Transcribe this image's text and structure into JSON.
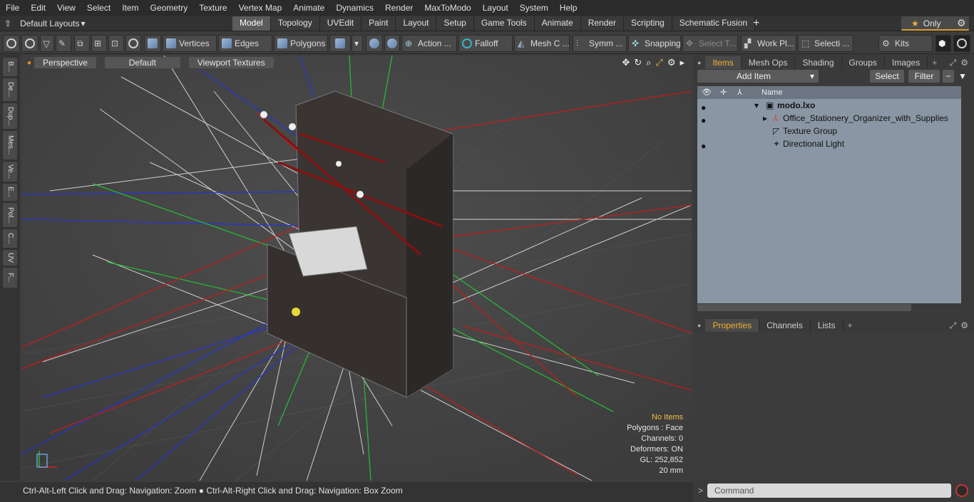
{
  "menu": [
    "File",
    "Edit",
    "View",
    "Select",
    "Item",
    "Geometry",
    "Texture",
    "Vertex Map",
    "Animate",
    "Dynamics",
    "Render",
    "MaxToModo",
    "Layout",
    "System",
    "Help"
  ],
  "layout_selector": "Default Layouts",
  "tabs": [
    {
      "label": "Model",
      "active": true
    },
    {
      "label": "Topology"
    },
    {
      "label": "UVEdit"
    },
    {
      "label": "Paint"
    },
    {
      "label": "Layout"
    },
    {
      "label": "Setup"
    },
    {
      "label": "Game Tools"
    },
    {
      "label": "Animate"
    },
    {
      "label": "Render"
    },
    {
      "label": "Scripting"
    },
    {
      "label": "Schematic Fusion"
    }
  ],
  "only_label": "Only",
  "toolbar": {
    "vertices": "Vertices",
    "edges": "Edges",
    "polygons": "Polygons",
    "action": "Action ...",
    "falloff": "Falloff",
    "mesh": "Mesh C ...",
    "symm": "Symm ...",
    "snapping": "Snapping",
    "select_t": "Select T...",
    "work_pl": "Work Pl...",
    "selecti": "Selecti ...",
    "kits": "Kits"
  },
  "left_tabs": [
    "B...",
    "De...",
    "Dup...",
    "Mes...",
    "Ve...",
    "E...",
    "Pol...",
    "C...",
    "UV",
    "F..."
  ],
  "viewport": {
    "view": "Perspective",
    "shading": "Default",
    "textures": "Viewport Textures",
    "info": {
      "no_items": "No Items",
      "polygons": "Polygons : Face",
      "channels": "Channels: 0",
      "deformers": "Deformers: ON",
      "gl": "GL: 252,852",
      "scale": "20 mm"
    }
  },
  "status": "Ctrl-Alt-Left Click and Drag: Navigation: Zoom ● Ctrl-Alt-Right Click and Drag: Navigation: Box Zoom",
  "right_panel": {
    "tabs": [
      "Items",
      "Mesh Ops",
      "Shading",
      "Groups",
      "Images"
    ],
    "add_item": "Add Item",
    "select": "Select",
    "filter": "Filter",
    "column_name": "Name",
    "items": [
      {
        "label": "modo.lxo"
      },
      {
        "label": "Office_Stationery_Organizer_with_Supplies"
      },
      {
        "label": "Texture Group"
      },
      {
        "label": "Directional Light"
      }
    ],
    "bottom_tabs": [
      "Properties",
      "Channels",
      "Lists"
    ],
    "command_placeholder": "Command"
  },
  "colors": {
    "accent": "#f0b030",
    "tree_bg": "#8a96a3",
    "viewport_bg": "#444444"
  }
}
